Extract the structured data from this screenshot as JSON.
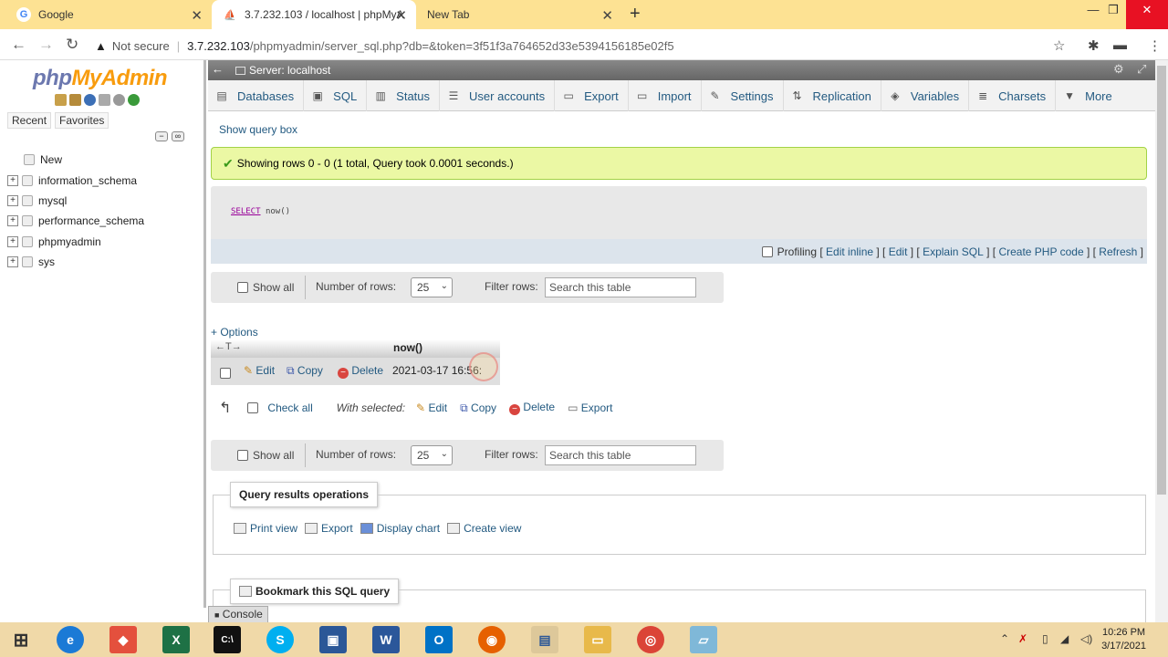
{
  "browser": {
    "tabs": [
      {
        "title": "Google",
        "active": false
      },
      {
        "title": "3.7.232.103 / localhost | phpMyA",
        "active": true
      },
      {
        "title": "New Tab",
        "active": false
      }
    ],
    "not_secure": "Not secure",
    "url_host": "3.7.232.103",
    "url_path": "/phpmyadmin/server_sql.php?db=&token=3f51f3a764652d33e5394156185e02f5"
  },
  "sidebar": {
    "logo_php": "php",
    "logo_my": "MyAdmin",
    "tabs": [
      "Recent",
      "Favorites"
    ],
    "tree": [
      {
        "label": "New"
      },
      {
        "label": "information_schema"
      },
      {
        "label": "mysql"
      },
      {
        "label": "performance_schema"
      },
      {
        "label": "phpmyadmin"
      },
      {
        "label": "sys"
      }
    ]
  },
  "server_bar": {
    "label": "Server: localhost"
  },
  "menu": [
    {
      "label": "Databases",
      "icon": "database-icon"
    },
    {
      "label": "SQL",
      "icon": "sql-icon"
    },
    {
      "label": "Status",
      "icon": "status-icon"
    },
    {
      "label": "User accounts",
      "icon": "users-icon"
    },
    {
      "label": "Export",
      "icon": "export-icon"
    },
    {
      "label": "Import",
      "icon": "import-icon"
    },
    {
      "label": "Settings",
      "icon": "settings-icon"
    },
    {
      "label": "Replication",
      "icon": "replication-icon"
    },
    {
      "label": "Variables",
      "icon": "variables-icon"
    },
    {
      "label": "Charsets",
      "icon": "charsets-icon"
    },
    {
      "label": "More",
      "icon": "chevron-down-icon"
    }
  ],
  "show_query_box": "Show query box",
  "success_msg": "Showing rows 0 - 0 (1 total, Query took 0.0001 seconds.)",
  "sql": {
    "keyword": "SELECT",
    "rest": "now()"
  },
  "sql_footer": {
    "profiling": "Profiling",
    "links": [
      "Edit inline",
      "Edit",
      "Explain SQL",
      "Create PHP code",
      "Refresh"
    ]
  },
  "nav": {
    "show_all": "Show all",
    "number_of_rows": "Number of rows:",
    "rows_value": "25",
    "filter_rows": "Filter rows:",
    "search_placeholder": "Search this table"
  },
  "options": "+ Options",
  "results": {
    "column": "now()",
    "row": {
      "edit": "Edit",
      "copy": "Copy",
      "delete": "Delete",
      "value": "2021-03-17 16:56:"
    }
  },
  "with_selected": {
    "check_all": "Check all",
    "label": "With selected:",
    "edit": "Edit",
    "copy": "Copy",
    "delete": "Delete",
    "export": "Export"
  },
  "qro": {
    "title": "Query results operations",
    "links": [
      "Print view",
      "Export",
      "Display chart",
      "Create view"
    ]
  },
  "bookmark": {
    "title": "Bookmark this SQL query"
  },
  "console": "Console",
  "clock": {
    "time": "10:26 PM",
    "date": "3/17/2021"
  }
}
